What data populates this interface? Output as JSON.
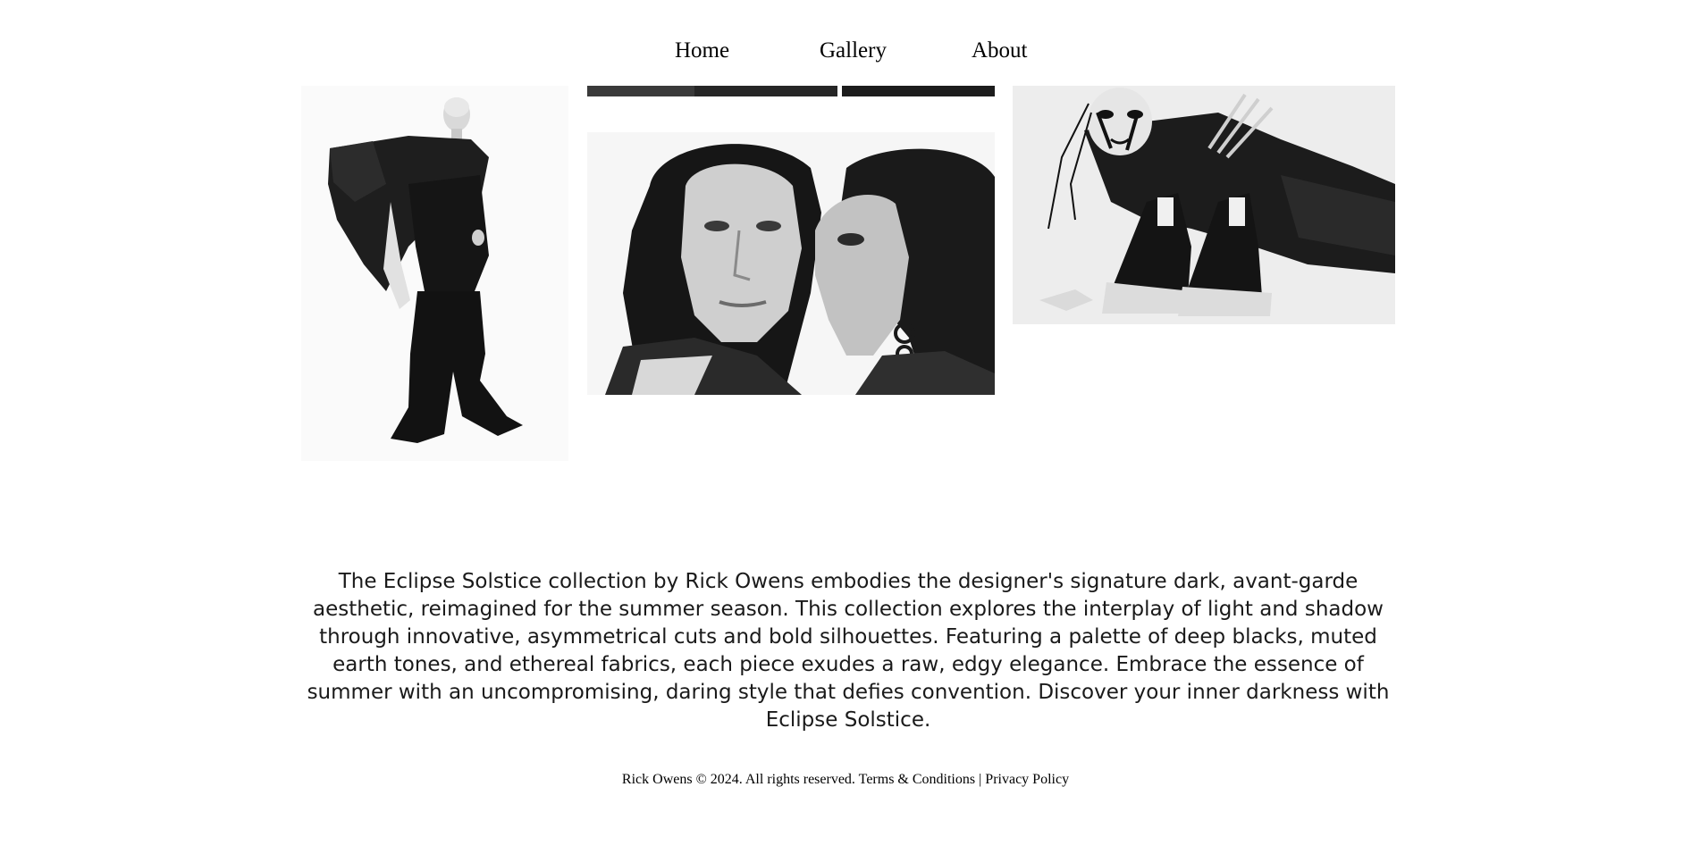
{
  "nav": {
    "home": "Home",
    "gallery": "Gallery",
    "about": "About"
  },
  "gallery": {
    "images": [
      {
        "name": "model-black-oversized-outfit",
        "tone": "monochrome"
      },
      {
        "name": "top-cropped-photo",
        "tone": "monochrome"
      },
      {
        "name": "designer-couple-portrait",
        "tone": "monochrome"
      },
      {
        "name": "model-leather-sneakers",
        "tone": "monochrome"
      }
    ]
  },
  "description": "The Eclipse Solstice collection by Rick Owens embodies the designer's signature dark, avant-garde aesthetic, reimagined for the summer season. This collection explores the interplay of light and shadow through innovative, asymmetrical cuts and bold silhouettes. Featuring a palette of deep blacks, muted earth tones, and ethereal fabrics, each piece exudes a raw, edgy elegance. Embrace the essence of summer with an uncompromising, daring style that defies convention. Discover your inner darkness with Eclipse Solstice.",
  "footer": {
    "copyright": "Rick Owens © 2024. All rights reserved.",
    "terms": "Terms & Conditions",
    "separator": "|",
    "privacy": "Privacy Policy"
  }
}
